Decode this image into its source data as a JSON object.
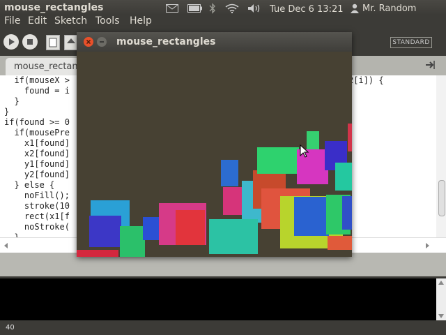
{
  "panel": {
    "app_title": "mouse_rectangles",
    "clock": "Tue Dec  6 13:21",
    "user": "Mr. Random"
  },
  "menus": [
    "File",
    "Edit",
    "Sketch",
    "Tools",
    "Help"
  ],
  "toolbar": {
    "mode": "STANDARD"
  },
  "tabs": {
    "active": "mouse_rectang"
  },
  "editor": {
    "lines": [
      "  if(mouseX >",
      "    found = i",
      "  }",
      "}",
      "if(found >= 0",
      "  if(mousePre",
      "    x1[found]",
      "    x2[found]",
      "    y1[found]",
      "    y2[found]",
      "  } else {",
      "    noFill();",
      "    stroke(10",
      "    rect(x1[f",
      "    noStroke(",
      "  }"
    ],
    "right_fragment": "2[i]) {"
  },
  "status": {
    "line_number": "40"
  },
  "sketch": {
    "title": "mouse_rectangles",
    "background": "#474133",
    "rects": [
      {
        "color": "#d4283e"
      },
      {
        "color": "#2aa0d6"
      },
      {
        "color": "#3c37c6"
      },
      {
        "color": "#2bc06a"
      },
      {
        "color": "#2a50d4"
      },
      {
        "color": "#d63a88"
      },
      {
        "color": "#e2343c"
      },
      {
        "color": "#d6347a"
      },
      {
        "color": "#2c6cd0"
      },
      {
        "color": "#3eb8cc"
      },
      {
        "color": "#c74a2c"
      },
      {
        "color": "#2ed26e"
      },
      {
        "color": "#e0543e"
      },
      {
        "color": "#b8d42c"
      },
      {
        "color": "#2a62d0"
      },
      {
        "color": "#2ec868"
      },
      {
        "color": "#36d070"
      },
      {
        "color": "#d636c0"
      },
      {
        "color": "#3a2ec8"
      },
      {
        "color": "#24c8a0"
      },
      {
        "color": "#d2344a"
      },
      {
        "color": "#3050c8"
      },
      {
        "color": "#e05a3a"
      },
      {
        "color": "#2cc2a4"
      }
    ]
  }
}
